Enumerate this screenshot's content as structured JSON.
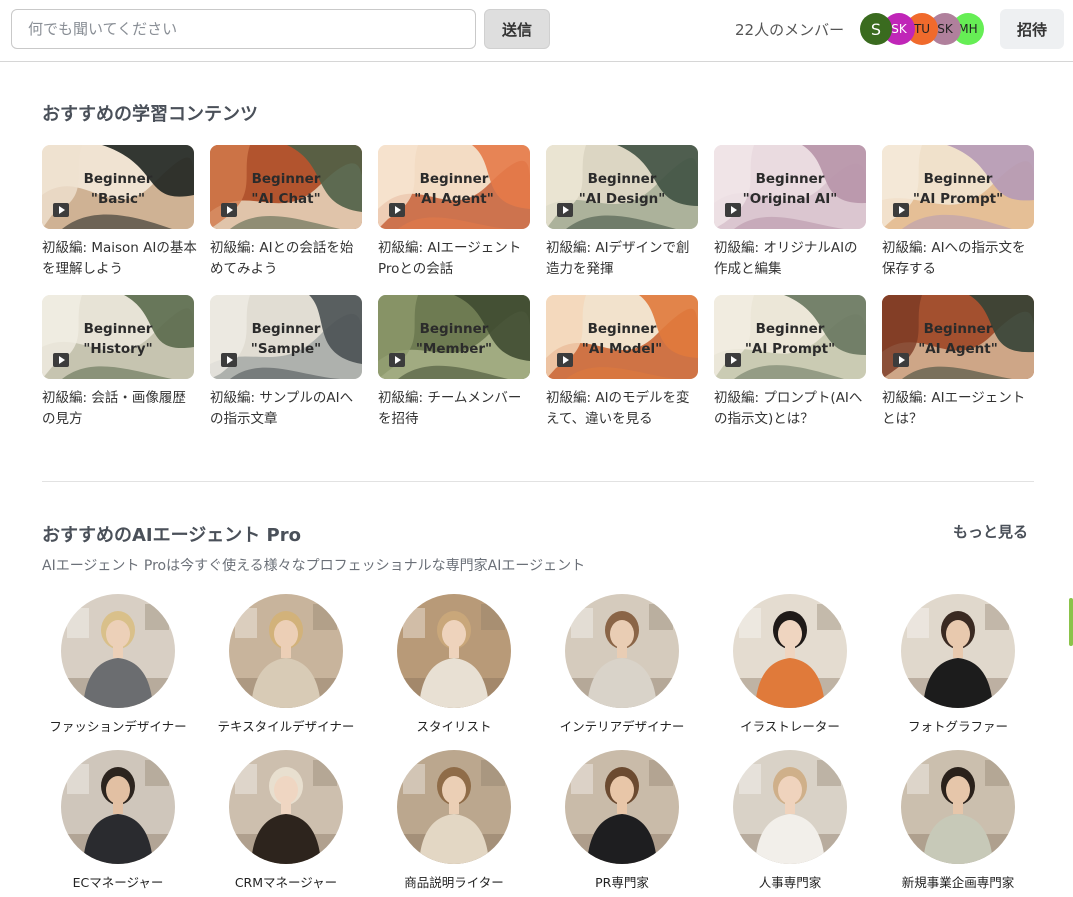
{
  "header": {
    "search_placeholder": "何でも聞いてください",
    "send_label": "送信",
    "member_count": "22人のメンバー",
    "invite_label": "招待",
    "avatars": [
      {
        "initials": "S",
        "color": "#3a6b1f",
        "text_color": "#ffffff"
      },
      {
        "initials": "SK",
        "color": "#c026b8",
        "text_color": "#ffffff"
      },
      {
        "initials": "TU",
        "color": "#f06a2c",
        "text_color": "#222222"
      },
      {
        "initials": "SK",
        "color": "#b0809c",
        "text_color": "#222222"
      },
      {
        "initials": "MH",
        "color": "#66ee55",
        "text_color": "#222222"
      }
    ]
  },
  "learning": {
    "title": "おすすめの学習コンテンツ",
    "cards": [
      {
        "line1": "Beginner",
        "line2": "\"Basic\"",
        "title": "初級編: Maison AIの基本を理解しよう",
        "palette": [
          "#f0e3d2",
          "#1e2320",
          "#c9a98a",
          "#efe1cf"
        ]
      },
      {
        "line1": "Beginner",
        "line2": "\"AI Chat\"",
        "title": "初級編: AIとの会話を始めてみよう",
        "palette": [
          "#b2542e",
          "#4f6147",
          "#e8d8c0",
          "#d27a4c"
        ]
      },
      {
        "line1": "Beginner",
        "line2": "\"AI Agent\"",
        "title": "初級編: AIエージェントProとの会話",
        "palette": [
          "#f3dcc4",
          "#e57a49",
          "#c6603a",
          "#f6e3cf"
        ]
      },
      {
        "line1": "Beginner",
        "line2": "\"AI Design\"",
        "title": "初級編: AIデザインで創造力を発揮",
        "palette": [
          "#dcd6c3",
          "#3f5142",
          "#a3ab94",
          "#eee7d6"
        ]
      },
      {
        "line1": "Beginner",
        "line2": "\"Original AI\"",
        "title": "初級編: オリジナルAIの作成と編集",
        "palette": [
          "#eadbe0",
          "#b793a8",
          "#d8c2cc",
          "#f1e6e8"
        ]
      },
      {
        "line1": "Beginner",
        "line2": "\"AI Prompt\"",
        "title": "初級編: AIへの指示文を保存する",
        "palette": [
          "#f0e1cb",
          "#b59ab6",
          "#e3b98d",
          "#f5ead9"
        ]
      },
      {
        "line1": "Beginner",
        "line2": "\"History\"",
        "title": "初級編: 会話・画像履歴の見方",
        "palette": [
          "#e7e3d6",
          "#5a6a4d",
          "#bfbea9",
          "#f1eee4"
        ]
      },
      {
        "line1": "Beginner",
        "line2": "\"Sample\"",
        "title": "初級編: サンプルのAIへの指示文章",
        "palette": [
          "#e1ddd3",
          "#4a5153",
          "#a5a9a6",
          "#efece5"
        ]
      },
      {
        "line1": "Beginner",
        "line2": "\"Member\"",
        "title": "初級編: チームメンバーを招待",
        "palette": [
          "#6e7b52",
          "#3f4b31",
          "#aab48a",
          "#8d9a6b"
        ]
      },
      {
        "line1": "Beginner",
        "line2": "\"AI Model\"",
        "title": "初級編: AIのモデルを変えて、違いを見る",
        "palette": [
          "#f2e2cc",
          "#e07a3c",
          "#c95f2d",
          "#f4d7b9"
        ]
      },
      {
        "line1": "Beginner",
        "line2": "\"AI Prompt\"",
        "title": "初級編: プロンプト(AIへの指示文)とは？",
        "palette": [
          "#ece7d8",
          "#68775f",
          "#c4c6ad",
          "#f2eee2"
        ]
      },
      {
        "line1": "Beginner",
        "line2": "\"AI Agent\"",
        "title": "初級編: AIエージェントとは？",
        "palette": [
          "#a3502f",
          "#354336",
          "#d6b597",
          "#7a3a24"
        ]
      }
    ]
  },
  "agents": {
    "title": "おすすめのAIエージェント Pro",
    "more_label": "もっと見る",
    "subtitle": "AIエージェント Proは今すぐ使える様々なプロフェッショナルな専門家AIエージェント",
    "items": [
      {
        "name": "ファッションデザイナー",
        "bg": "#d8cfc4",
        "hair": "#d9c08a",
        "outfit": "#6b6d70",
        "skin": "#ecd0b8"
      },
      {
        "name": "テキスタイルデザイナー",
        "bg": "#c8b49c",
        "hair": "#d2b27a",
        "outfit": "#d8cbb6",
        "skin": "#eccfb6"
      },
      {
        "name": "スタイリスト",
        "bg": "#b89a78",
        "hair": "#c9a77a",
        "outfit": "#e8e0d3",
        "skin": "#eed3bc"
      },
      {
        "name": "インテリアデザイナー",
        "bg": "#d5cbbd",
        "hair": "#8a6547",
        "outfit": "#d9d3c9",
        "skin": "#e9cdb4"
      },
      {
        "name": "イラストレーター",
        "bg": "#e4dcd0",
        "hair": "#1f1a18",
        "outfit": "#e07a3a",
        "skin": "#efd5c0"
      },
      {
        "name": "フォトグラファー",
        "bg": "#e0d8cc",
        "hair": "#3a2a22",
        "outfit": "#1c1c1c",
        "skin": "#e8c9ae"
      },
      {
        "name": "ECマネージャー",
        "bg": "#cfc6bb",
        "hair": "#2c241e",
        "outfit": "#2a2b2f",
        "skin": "#e2c0a3"
      },
      {
        "name": "CRMマネージャー",
        "bg": "#cdbfae",
        "hair": "#e8dfcf",
        "outfit": "#2d241d",
        "skin": "#efd6c2"
      },
      {
        "name": "商品説明ライター",
        "bg": "#bba78e",
        "hair": "#8f6c48",
        "outfit": "#e3d7c4",
        "skin": "#ebcfb5"
      },
      {
        "name": "PR専門家",
        "bg": "#c9bba9",
        "hair": "#6b4a30",
        "outfit": "#1e1e20",
        "skin": "#e8c6a8"
      },
      {
        "name": "人事専門家",
        "bg": "#d9d2c7",
        "hair": "#cfb08a",
        "outfit": "#f2efea",
        "skin": "#efd3bd"
      },
      {
        "name": "新規事業企画専門家",
        "bg": "#cbbfae",
        "hair": "#2a211b",
        "outfit": "#c7c9b8",
        "skin": "#e6c6aa"
      }
    ]
  }
}
